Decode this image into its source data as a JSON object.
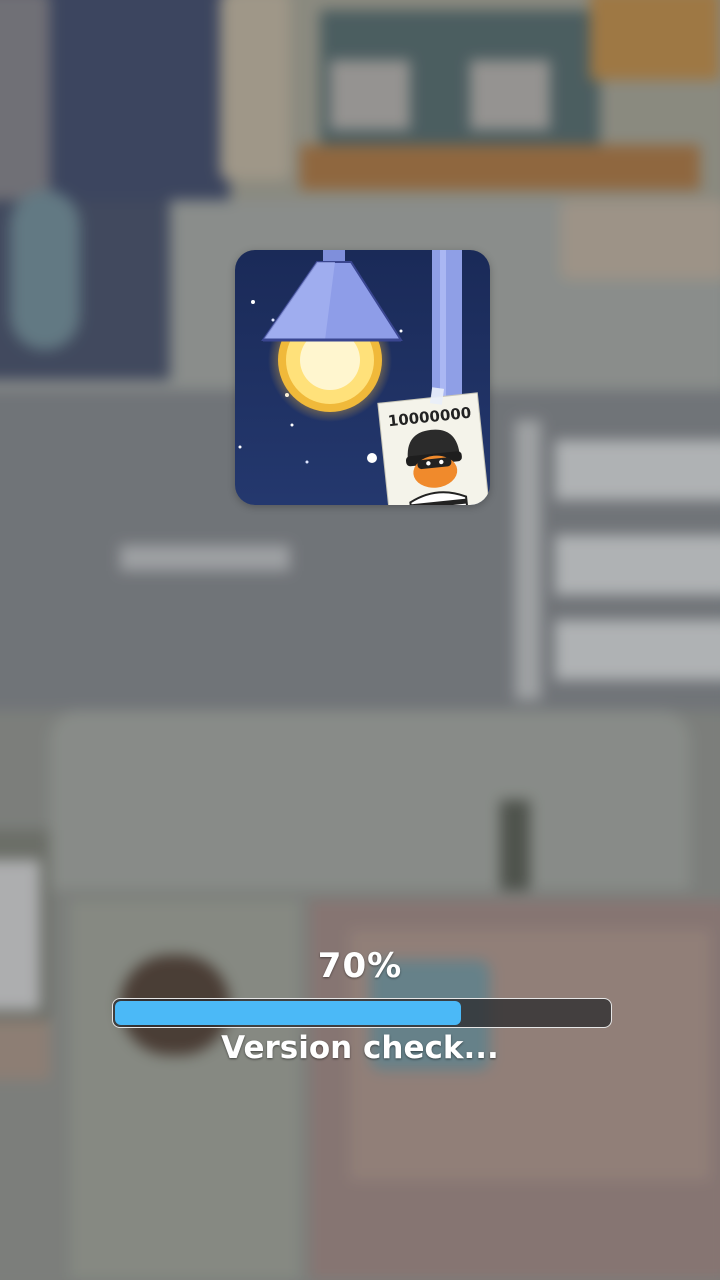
{
  "app_icon": {
    "icon": "thief-wanted-poster-lamp-icon",
    "reward_text": "10000000"
  },
  "loading": {
    "percent_label": "70%",
    "progress": 0.7,
    "status": "Version check..."
  },
  "colors": {
    "progress_fill": "#4bb9f7",
    "progress_track": "#2d2d30",
    "icon_background": "#1c2b5c",
    "lamp_shade": "#8e9de8"
  }
}
